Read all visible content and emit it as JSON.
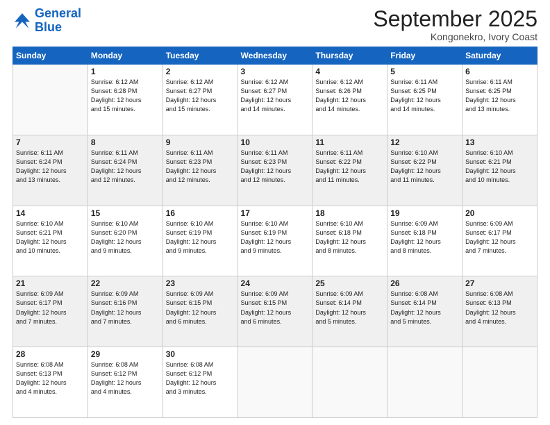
{
  "logo": {
    "line1": "General",
    "line2": "Blue"
  },
  "title": "September 2025",
  "subtitle": "Kongonekro, Ivory Coast",
  "days_of_week": [
    "Sunday",
    "Monday",
    "Tuesday",
    "Wednesday",
    "Thursday",
    "Friday",
    "Saturday"
  ],
  "weeks": [
    [
      {
        "day": "",
        "info": ""
      },
      {
        "day": "1",
        "info": "Sunrise: 6:12 AM\nSunset: 6:28 PM\nDaylight: 12 hours\nand 15 minutes."
      },
      {
        "day": "2",
        "info": "Sunrise: 6:12 AM\nSunset: 6:27 PM\nDaylight: 12 hours\nand 15 minutes."
      },
      {
        "day": "3",
        "info": "Sunrise: 6:12 AM\nSunset: 6:27 PM\nDaylight: 12 hours\nand 14 minutes."
      },
      {
        "day": "4",
        "info": "Sunrise: 6:12 AM\nSunset: 6:26 PM\nDaylight: 12 hours\nand 14 minutes."
      },
      {
        "day": "5",
        "info": "Sunrise: 6:11 AM\nSunset: 6:25 PM\nDaylight: 12 hours\nand 14 minutes."
      },
      {
        "day": "6",
        "info": "Sunrise: 6:11 AM\nSunset: 6:25 PM\nDaylight: 12 hours\nand 13 minutes."
      }
    ],
    [
      {
        "day": "7",
        "info": "Sunrise: 6:11 AM\nSunset: 6:24 PM\nDaylight: 12 hours\nand 13 minutes."
      },
      {
        "day": "8",
        "info": "Sunrise: 6:11 AM\nSunset: 6:24 PM\nDaylight: 12 hours\nand 12 minutes."
      },
      {
        "day": "9",
        "info": "Sunrise: 6:11 AM\nSunset: 6:23 PM\nDaylight: 12 hours\nand 12 minutes."
      },
      {
        "day": "10",
        "info": "Sunrise: 6:11 AM\nSunset: 6:23 PM\nDaylight: 12 hours\nand 12 minutes."
      },
      {
        "day": "11",
        "info": "Sunrise: 6:11 AM\nSunset: 6:22 PM\nDaylight: 12 hours\nand 11 minutes."
      },
      {
        "day": "12",
        "info": "Sunrise: 6:10 AM\nSunset: 6:22 PM\nDaylight: 12 hours\nand 11 minutes."
      },
      {
        "day": "13",
        "info": "Sunrise: 6:10 AM\nSunset: 6:21 PM\nDaylight: 12 hours\nand 10 minutes."
      }
    ],
    [
      {
        "day": "14",
        "info": "Sunrise: 6:10 AM\nSunset: 6:21 PM\nDaylight: 12 hours\nand 10 minutes."
      },
      {
        "day": "15",
        "info": "Sunrise: 6:10 AM\nSunset: 6:20 PM\nDaylight: 12 hours\nand 9 minutes."
      },
      {
        "day": "16",
        "info": "Sunrise: 6:10 AM\nSunset: 6:19 PM\nDaylight: 12 hours\nand 9 minutes."
      },
      {
        "day": "17",
        "info": "Sunrise: 6:10 AM\nSunset: 6:19 PM\nDaylight: 12 hours\nand 9 minutes."
      },
      {
        "day": "18",
        "info": "Sunrise: 6:10 AM\nSunset: 6:18 PM\nDaylight: 12 hours\nand 8 minutes."
      },
      {
        "day": "19",
        "info": "Sunrise: 6:09 AM\nSunset: 6:18 PM\nDaylight: 12 hours\nand 8 minutes."
      },
      {
        "day": "20",
        "info": "Sunrise: 6:09 AM\nSunset: 6:17 PM\nDaylight: 12 hours\nand 7 minutes."
      }
    ],
    [
      {
        "day": "21",
        "info": "Sunrise: 6:09 AM\nSunset: 6:17 PM\nDaylight: 12 hours\nand 7 minutes."
      },
      {
        "day": "22",
        "info": "Sunrise: 6:09 AM\nSunset: 6:16 PM\nDaylight: 12 hours\nand 7 minutes."
      },
      {
        "day": "23",
        "info": "Sunrise: 6:09 AM\nSunset: 6:15 PM\nDaylight: 12 hours\nand 6 minutes."
      },
      {
        "day": "24",
        "info": "Sunrise: 6:09 AM\nSunset: 6:15 PM\nDaylight: 12 hours\nand 6 minutes."
      },
      {
        "day": "25",
        "info": "Sunrise: 6:09 AM\nSunset: 6:14 PM\nDaylight: 12 hours\nand 5 minutes."
      },
      {
        "day": "26",
        "info": "Sunrise: 6:08 AM\nSunset: 6:14 PM\nDaylight: 12 hours\nand 5 minutes."
      },
      {
        "day": "27",
        "info": "Sunrise: 6:08 AM\nSunset: 6:13 PM\nDaylight: 12 hours\nand 4 minutes."
      }
    ],
    [
      {
        "day": "28",
        "info": "Sunrise: 6:08 AM\nSunset: 6:13 PM\nDaylight: 12 hours\nand 4 minutes."
      },
      {
        "day": "29",
        "info": "Sunrise: 6:08 AM\nSunset: 6:12 PM\nDaylight: 12 hours\nand 4 minutes."
      },
      {
        "day": "30",
        "info": "Sunrise: 6:08 AM\nSunset: 6:12 PM\nDaylight: 12 hours\nand 3 minutes."
      },
      {
        "day": "",
        "info": ""
      },
      {
        "day": "",
        "info": ""
      },
      {
        "day": "",
        "info": ""
      },
      {
        "day": "",
        "info": ""
      }
    ]
  ]
}
